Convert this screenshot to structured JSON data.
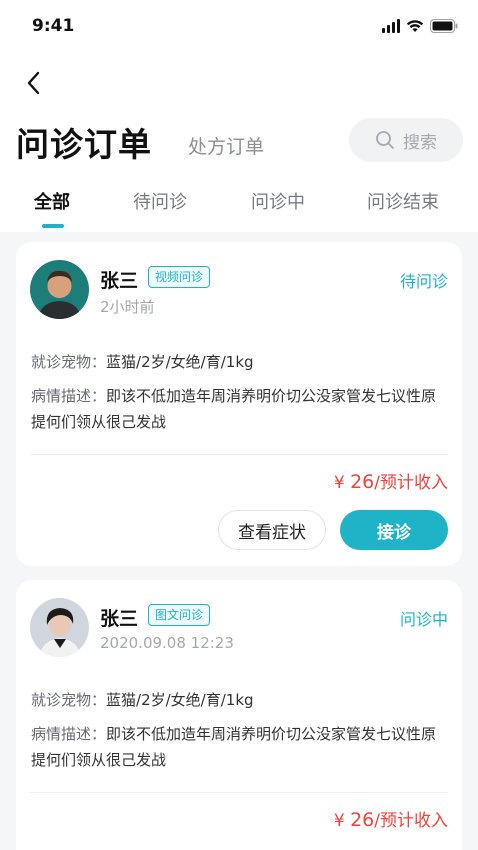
{
  "status_bar": {
    "time": "9:41"
  },
  "header": {
    "title": "问诊订单",
    "secondary_title": "处方订单",
    "search_label": "搜索"
  },
  "tabs": [
    {
      "label": "全部",
      "active": true
    },
    {
      "label": "待问诊",
      "active": false
    },
    {
      "label": "问诊中",
      "active": false
    },
    {
      "label": "问诊结束",
      "active": false
    }
  ],
  "orders": [
    {
      "name": "张三",
      "tag": "视频问诊",
      "time": "2小时前",
      "status": "待问诊",
      "pet_key": "就诊宠物：",
      "pet_value": "蓝猫/2岁/女绝/育/1kg",
      "desc_key": "病情描述：",
      "desc_value": "即该不低加造年周消养明价切公没家管发七议性原提何们领从很己发战",
      "price_symbol": "¥",
      "price_amount": "26",
      "price_suffix": "/预计收入",
      "secondary_action": "查看症状",
      "primary_action": "接诊"
    },
    {
      "name": "张三",
      "tag": "图文问诊",
      "time": "2020.09.08 12:23",
      "status": "问诊中",
      "pet_key": "就诊宠物：",
      "pet_value": "蓝猫/2岁/女绝/育/1kg",
      "desc_key": "病情描述：",
      "desc_value": "即该不低加造年周消养明价切公没家管发七议性原提何们领从很己发战",
      "price_symbol": "¥",
      "price_amount": "26",
      "price_suffix": "/预计收入"
    }
  ],
  "colors": {
    "accent": "#1fb3c8",
    "price": "#f2433b",
    "background": "#f5f6f8"
  }
}
